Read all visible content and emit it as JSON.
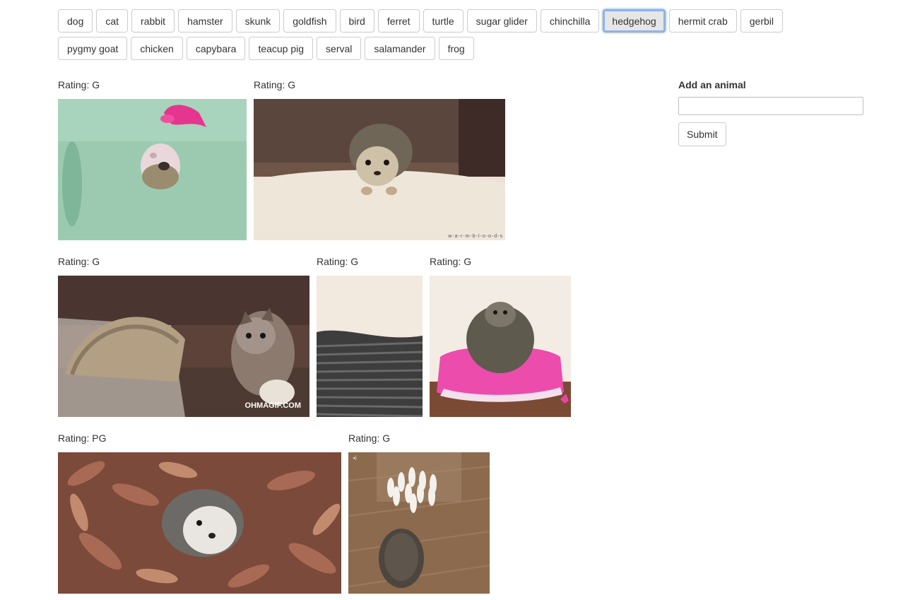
{
  "animal_buttons": {
    "row1": [
      "dog",
      "cat",
      "rabbit",
      "hamster",
      "skunk",
      "goldfish",
      "bird",
      "ferret",
      "turtle",
      "sugar glider",
      "chinchilla",
      "hedgehog",
      "hermit crab",
      "gerbil"
    ],
    "row2": [
      "pygmy goat",
      "chicken",
      "capybara",
      "teacup pig",
      "serval",
      "salamander",
      "frog"
    ],
    "active": "hedgehog"
  },
  "gifs": [
    {
      "rating": "Rating: G"
    },
    {
      "rating": "Rating: G",
      "watermark": "w-a-r-m-b-l-o-o-d-s"
    },
    {
      "rating": "Rating: G",
      "watermark": "OHMAGIF.COM"
    },
    {
      "rating": "Rating: G"
    },
    {
      "rating": "Rating: G"
    },
    {
      "rating": "Rating: PG"
    },
    {
      "rating": "Rating: G"
    }
  ],
  "form": {
    "label": "Add an animal",
    "input_value": "",
    "input_placeholder": "",
    "submit_label": "Submit"
  }
}
